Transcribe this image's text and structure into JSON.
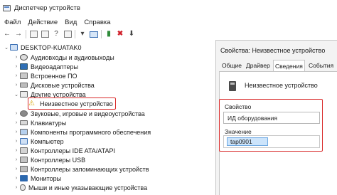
{
  "window": {
    "title": "Диспетчер устройств",
    "icon": "device-manager-icon"
  },
  "menu": {
    "items": [
      "Файл",
      "Действие",
      "Вид",
      "Справка"
    ]
  },
  "toolbar": {
    "buttons": [
      "back-arrow-icon",
      "forward-arrow-icon",
      "properties-icon",
      "scan-hardware-icon",
      "help-icon",
      "view-icon",
      "update-driver-icon",
      "monitor-icon",
      "enable-device-icon",
      "uninstall-device-icon",
      "download-icon"
    ]
  },
  "tree": {
    "root": "DESKTOP-KUATAK0",
    "items": [
      {
        "label": "Аудиовходы и аудиовыходы",
        "icon": "audio-icon",
        "expander": ">"
      },
      {
        "label": "Видеоадаптеры",
        "icon": "video-adapter-icon",
        "expander": ">"
      },
      {
        "label": "Встроенное ПО",
        "icon": "firmware-icon",
        "expander": ">"
      },
      {
        "label": "Дисковые устройства",
        "icon": "disk-icon",
        "expander": ">"
      },
      {
        "label": "Другие устройства",
        "icon": "other-devices-icon",
        "expander": "v"
      },
      {
        "label": "Неизвестное устройство",
        "icon": "warning-icon",
        "expander": ""
      },
      {
        "label": "Звуковые, игровые и видеоустройства",
        "icon": "sound-icon",
        "expander": ">"
      },
      {
        "label": "Клавиатуры",
        "icon": "keyboard-icon",
        "expander": ">"
      },
      {
        "label": "Компоненты программного обеспечения",
        "icon": "software-component-icon",
        "expander": ">"
      },
      {
        "label": "Компьютер",
        "icon": "computer-icon",
        "expander": ">"
      },
      {
        "label": "Контроллеры IDE ATA/ATAPI",
        "icon": "ide-controller-icon",
        "expander": ">"
      },
      {
        "label": "Контроллеры USB",
        "icon": "usb-controller-icon",
        "expander": ">"
      },
      {
        "label": "Контроллеры запоминающих устройств",
        "icon": "storage-controller-icon",
        "expander": ">"
      },
      {
        "label": "Мониторы",
        "icon": "monitor-icon",
        "expander": ">"
      },
      {
        "label": "Мыши и иные указывающие устройства",
        "icon": "mouse-icon",
        "expander": ">"
      }
    ]
  },
  "dialog": {
    "title": "Свойства: Неизвестное устройство",
    "tabs": [
      "Общие",
      "Драйвер",
      "Сведения",
      "События"
    ],
    "active_tab": "Сведения",
    "device_name": "Неизвестное устройство",
    "property_label": "Свойство",
    "property_value": "ИД оборудования",
    "value_label": "Значение",
    "value": "tap0901"
  }
}
